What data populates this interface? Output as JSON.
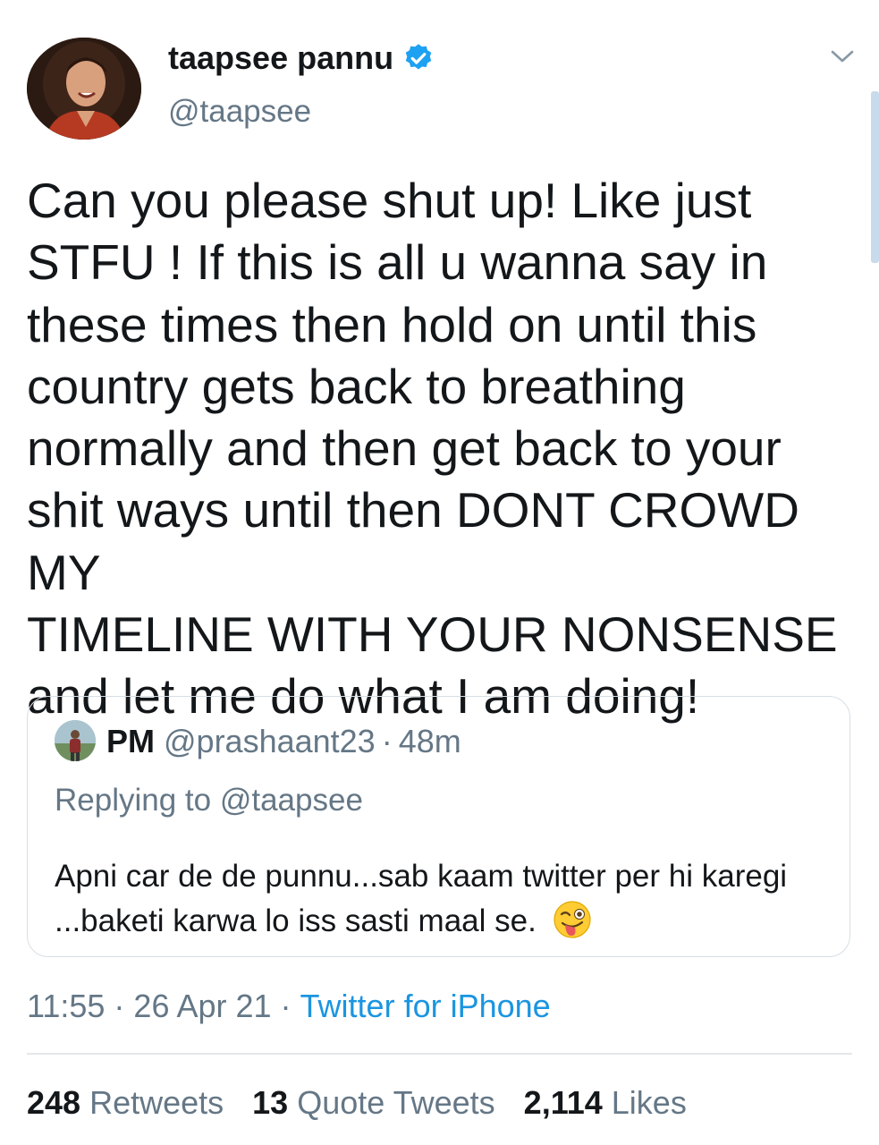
{
  "author": {
    "display_name": "taapsee pannu",
    "handle": "@taapsee",
    "verified": true,
    "verified_icon": "verified-badge-icon",
    "accent_color": "#1da1f2"
  },
  "tweet": {
    "text": "Can you please shut up! Like just\nSTFU ! If this is all u wanna say in\nthese times then hold on until this\ncountry gets back to breathing\nnormally and then get back to your\nshit ways until then DONT CROWD MY\nTIMELINE WITH YOUR NONSENSE\nand let me do what I am doing!"
  },
  "quoted_tweet": {
    "name": "PM",
    "handle": "@prashaant23",
    "separator": "·",
    "time": "48m",
    "replying_to": "Replying to @taapsee",
    "text": "Apni car de de punnu...sab kaam twitter per hi karegi ...baketi karwa lo iss sasti maal se.",
    "emoji": "winking-face-with-tongue-emoji"
  },
  "meta": {
    "time": "11:55",
    "separator": "·",
    "date": "26 Apr 21",
    "source": "Twitter for iPhone",
    "source_color": "#1b95e0"
  },
  "stats": {
    "retweets_count": "248",
    "retweets_label": "Retweets",
    "quotes_count": "13",
    "quotes_label": "Quote Tweets",
    "likes_count": "2,114",
    "likes_label": "Likes"
  },
  "colors": {
    "text": "#14171a",
    "secondary": "#657786",
    "border": "#d7dfe5"
  }
}
